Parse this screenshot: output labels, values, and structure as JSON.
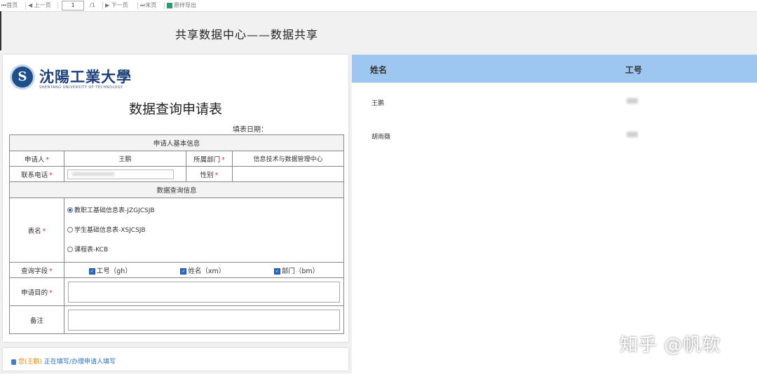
{
  "toolbar": {
    "first": "首页",
    "prev": "上一页",
    "page_value": "1",
    "page_total": "/1",
    "next": "下一页",
    "last": "末页",
    "export": "原样导出"
  },
  "page_title": "共享数据中心——数据共享",
  "logo": {
    "seal": "S",
    "cn": "沈陽工業大學",
    "en": "SHENYANG UNIVERSITY OF TECHNOLOGY"
  },
  "form": {
    "title": "数据查询申请表",
    "fill_date_label": "填表日期：",
    "section_basic": "申请人基本信息",
    "applicant_label": "申请人",
    "applicant_value": "王鹏",
    "dept_label": "所属部门",
    "dept_value": "信息技术与数据管理中心",
    "phone_label": "联系电话",
    "gender_label": "性别",
    "section_query": "数据查询信息",
    "table_label": "表名",
    "table_options": [
      "教职工基础信息表-JZGJCSJB",
      "学生基础信息表-XSJCSJB",
      "课程表-KCB"
    ],
    "fields_label": "查询字段",
    "field_options": [
      "工号（gh）",
      "姓名（xm）",
      "部门（bm）"
    ],
    "purpose_label": "申请目的",
    "remark_label": "备注"
  },
  "status": {
    "user": "您(王鹏)",
    "rest": "正在填写/办理申请人填写"
  },
  "list": {
    "col_name": "姓名",
    "col_id": "工号",
    "rows": [
      {
        "name": "王鹏"
      },
      {
        "name": "胡雨薇"
      }
    ]
  },
  "watermark": "知乎 @帆软",
  "colors": {
    "header_blue": "#9dc6f0",
    "required_red": "#dd3333",
    "accent_blue": "#2a6bc9"
  }
}
